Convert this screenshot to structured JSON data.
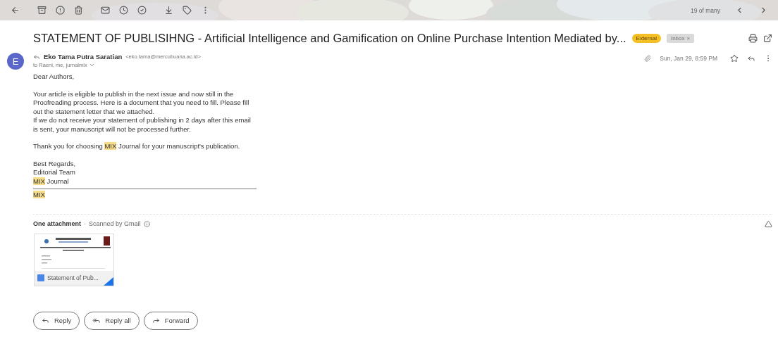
{
  "toolbar": {
    "counter": "19 of many"
  },
  "subject": {
    "text": "STATEMENT OF PUBLISIHNG - Artificial Intelligence and Gamification on Online Purchase Intention Mediated by...",
    "labels": [
      {
        "text": "External",
        "color": "#f5bf26"
      },
      {
        "text": "Inbox",
        "color": "#dadada",
        "remove": "×"
      }
    ]
  },
  "message": {
    "avatar": "E",
    "sender": "Eko Tama Putra Saratian",
    "email": "<eko.tama@mercubuana.ac.id>",
    "recipients": "to Raeni, me, jurnalmix",
    "date": "Sun, Jan 29, 8:59 PM",
    "starred": false,
    "paragraphs": [
      [
        [
          {
            "text": "Dear Authors,"
          }
        ]
      ],
      [
        [
          {
            "text": "Your article is eligible to publish in the next issue and now still in the"
          }
        ],
        [
          {
            "text": "Proofreading process. Here is a document that you need to fill. Please fill"
          }
        ],
        [
          {
            "text": "out the statement letter that we attached."
          }
        ],
        [
          {
            "text": "If we do not receive your statement of publishing in 2 days after this email"
          }
        ],
        [
          {
            "text": "is sent, your manuscript will not be processed further."
          }
        ]
      ],
      [
        [
          {
            "text": "Thank you for choosing "
          },
          {
            "text": "MIX",
            "highlighted": true
          },
          {
            "text": " Journal for your manuscript's publication."
          }
        ]
      ],
      [
        [
          {
            "text": "Best Regards,"
          }
        ],
        [
          {
            "text": "Editorial Team"
          }
        ],
        [
          {
            "text": "MIX",
            "highlighted": true
          },
          {
            "text": " Journal"
          }
        ]
      ]
    ],
    "signature": [
      {
        "text": "MIX",
        "highlighted": true
      }
    ]
  },
  "attachments": {
    "title": "One attachment",
    "separator": "·",
    "scanned": "Scanned by Gmail",
    "files": [
      {
        "kind": "picture",
        "name": "Statement of Pub..."
      }
    ]
  },
  "actions": [
    "Reply",
    "Reply all",
    "Forward"
  ]
}
